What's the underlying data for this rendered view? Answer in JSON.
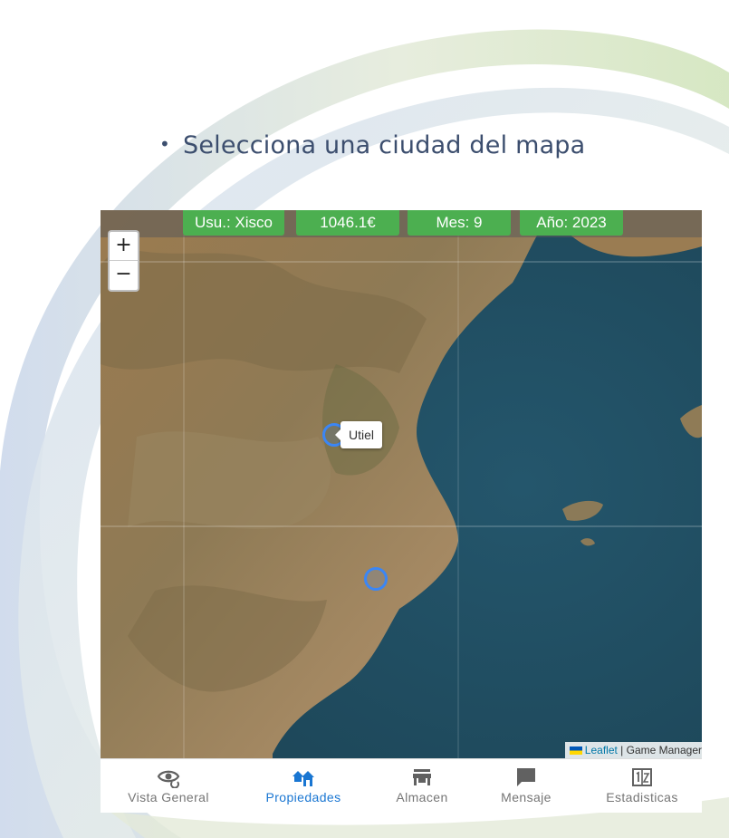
{
  "slide": {
    "bullet": "Selecciona una ciudad del mapa"
  },
  "status": {
    "user": "Usu.: Xisco",
    "money": "1046.1€",
    "month": "Mes: 9",
    "year": "Año: 2023"
  },
  "map": {
    "zoom_in": "+",
    "zoom_out": "−",
    "city_tooltip": "Utiel",
    "attribution": {
      "link": "Leaflet",
      "separator": " | ",
      "rest": "Game Manager"
    }
  },
  "nav": {
    "items": [
      {
        "label": "Vista General",
        "icon": "eye-refresh-icon"
      },
      {
        "label": "Propiedades",
        "icon": "houses-icon"
      },
      {
        "label": "Almacen",
        "icon": "store-icon"
      },
      {
        "label": "Mensaje",
        "icon": "message-icon"
      },
      {
        "label": "Estadisticas",
        "icon": "scoreboard-icon"
      }
    ],
    "active_index": 1
  },
  "colors": {
    "pill_green": "#4caf50",
    "marker_blue": "#3b86f5",
    "active_nav": "#1976d2",
    "bullet_text": "#3c4e6e"
  }
}
